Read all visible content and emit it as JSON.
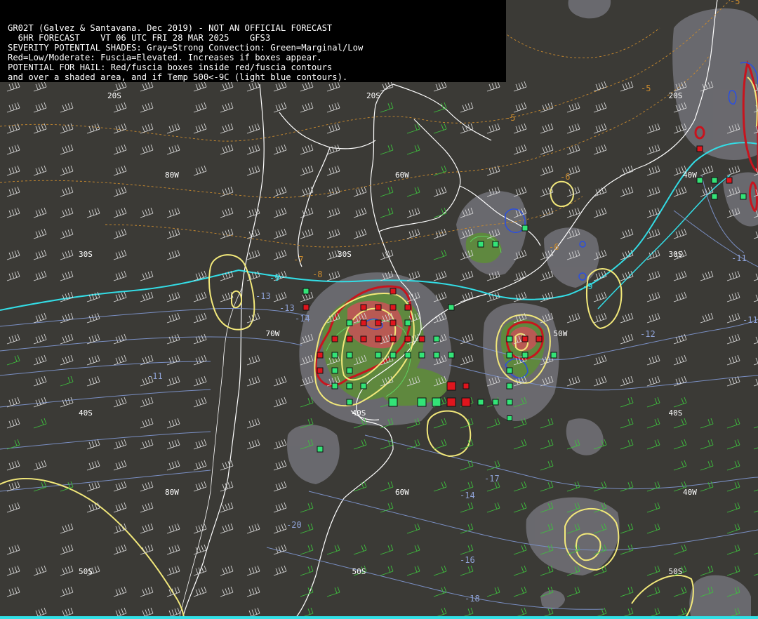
{
  "header": {
    "lines": [
      "GR02T (Galvez & Santavana. Dec 2019) - NOT AN OFFICIAL FORECAST",
      "  6HR FORECAST    VT 06 UTC FRI 28 MAR 2025    GFS3",
      "SEVERITY POTENTIAL SHADES: Gray=Strong Convection: Green=Marginal/Low",
      "Red=Low/Moderate: Fuscia=Elevated. Increases if boxes appear.",
      "POTENTIAL FOR HAIL: Red/fuscia boxes inside red/fuscia contours",
      "and over a shaded area, and if Temp 500<-9C (light blue contours)."
    ]
  },
  "grid_labels": [
    {
      "text": "20S",
      "lon": -80,
      "lat": -20
    },
    {
      "text": "20S",
      "lon": -62,
      "lat": -20
    },
    {
      "text": "20S",
      "lon": -41,
      "lat": -20
    },
    {
      "text": "50W",
      "lon": -48,
      "lat": -11
    },
    {
      "text": "80W",
      "lon": -76,
      "lat": -25
    },
    {
      "text": "60W",
      "lon": -60,
      "lat": -25
    },
    {
      "text": "40W",
      "lon": -40,
      "lat": -25
    },
    {
      "text": "30S",
      "lon": -82,
      "lat": -30
    },
    {
      "text": "30S",
      "lon": -64,
      "lat": -30
    },
    {
      "text": "30S",
      "lon": -41,
      "lat": -30
    },
    {
      "text": "70W",
      "lon": -69,
      "lat": -35
    },
    {
      "text": "50W",
      "lon": -49,
      "lat": -35
    },
    {
      "text": "40S",
      "lon": -82,
      "lat": -40
    },
    {
      "text": "40S",
      "lon": -63,
      "lat": -40
    },
    {
      "text": "40S",
      "lon": -41,
      "lat": -40
    },
    {
      "text": "80W",
      "lon": -76,
      "lat": -45
    },
    {
      "text": "60W",
      "lon": -60,
      "lat": -45
    },
    {
      "text": "40W",
      "lon": -40,
      "lat": -45
    },
    {
      "text": "50S",
      "lon": -82,
      "lat": -50
    },
    {
      "text": "50S",
      "lon": -63,
      "lat": -50
    },
    {
      "text": "50S",
      "lon": -41,
      "lat": -50
    }
  ],
  "contour_labels_orange": [
    "-5",
    "-5",
    "-5",
    "-7",
    "-8",
    "-6",
    "-6"
  ],
  "contour_labels_cyan": [
    "-9",
    "-9"
  ],
  "contour_labels_blue": [
    "-13",
    "-11",
    "-11",
    "-12",
    "-13",
    "-14",
    "-17",
    "-14",
    "-20",
    "-16",
    "-18",
    "-11"
  ],
  "colors": {
    "background": "#3b3a36",
    "gray_shade": "#6e6e73",
    "green_shade": "#5f8a3c",
    "red_shade": "#c0504a",
    "yellow_contour": "#f2e87a",
    "red_contour": "#c8141e",
    "cyan_contour": "#33dde6",
    "blue_contour": "#7a8fc4",
    "orange_contour": "#c98a2e",
    "wind_barbs": "#d8d8d8",
    "green_barbs": "#3ec23e",
    "box_green": "#33e377",
    "box_red": "#e0151d"
  }
}
